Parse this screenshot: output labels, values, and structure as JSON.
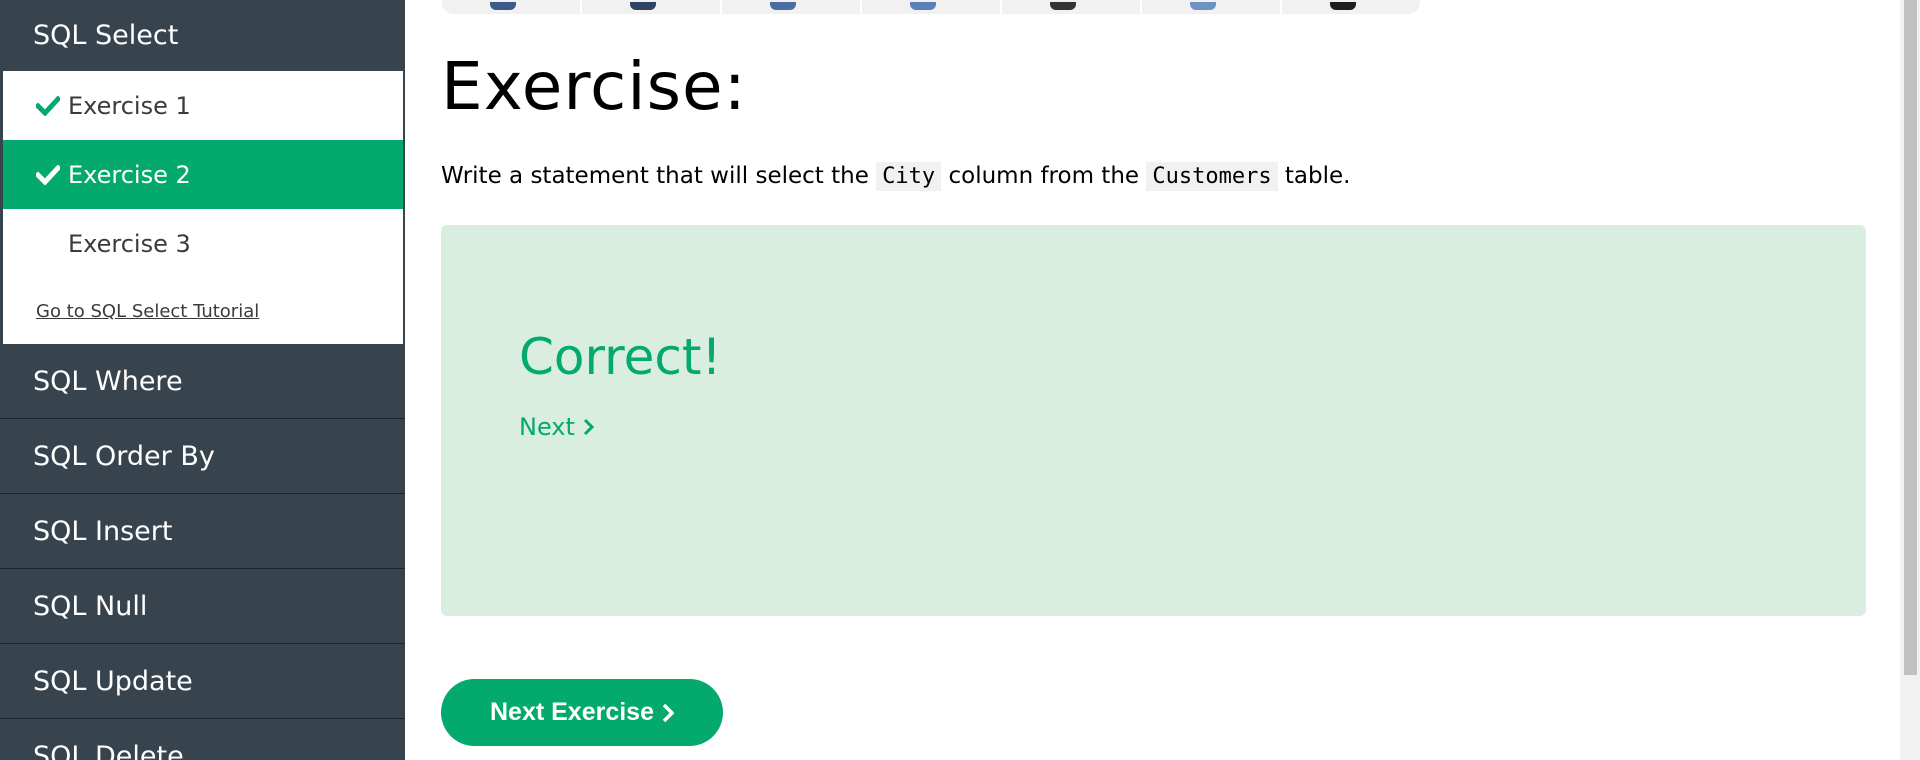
{
  "sidebar": {
    "current_section": "SQL Select",
    "exercises": [
      {
        "label": "Exercise 1",
        "completed": true,
        "active": false
      },
      {
        "label": "Exercise 2",
        "completed": true,
        "active": true
      },
      {
        "label": "Exercise 3",
        "completed": false,
        "active": false
      }
    ],
    "tutorial_link": "Go to SQL Select Tutorial",
    "sections": [
      "SQL Where",
      "SQL Order By",
      "SQL Insert",
      "SQL Null",
      "SQL Update",
      "SQL Delete"
    ]
  },
  "main": {
    "title": "Exercise:",
    "instruction": {
      "part1": "Write a statement that will select the ",
      "code1": "City",
      "part2": " column from the ",
      "code2": "Customers",
      "part3": " table."
    },
    "result": {
      "title": "Correct!",
      "next_label": "Next"
    },
    "next_exercise_label": "Next Exercise"
  },
  "colors": {
    "accent": "#04aa6d",
    "sidebar_bg": "#38444d",
    "result_bg": "#d9eee1"
  },
  "icons": {
    "check": "check-icon",
    "chevron": "chevron-right-icon"
  }
}
